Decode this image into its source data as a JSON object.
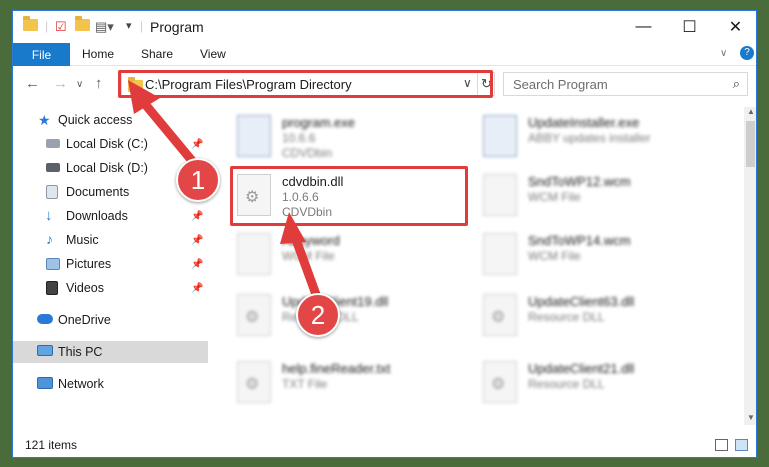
{
  "window": {
    "title": "Program",
    "minimize": "—",
    "maximize": "☐",
    "close": "✕"
  },
  "ribbon": {
    "file": "File",
    "tabs": [
      "Home",
      "Share",
      "View"
    ]
  },
  "address": {
    "path": "C:\\Program Files\\Program Directory",
    "search_placeholder": "Search Program"
  },
  "sidebar": [
    {
      "label": "Quick access",
      "icon": "star-icon",
      "pinned": false
    },
    {
      "label": "Local Disk (C:)",
      "icon": "drive-icon",
      "pinned": true
    },
    {
      "label": "Local Disk (D:)",
      "icon": "drive-icon",
      "pinned": false
    },
    {
      "label": "Documents",
      "icon": "documents-icon",
      "pinned": true
    },
    {
      "label": "Downloads",
      "icon": "download-icon",
      "pinned": true
    },
    {
      "label": "Music",
      "icon": "music-icon",
      "pinned": true
    },
    {
      "label": "Pictures",
      "icon": "pictures-icon",
      "pinned": true
    },
    {
      "label": "Videos",
      "icon": "videos-icon",
      "pinned": true
    },
    {
      "label": "OneDrive",
      "icon": "cloud-icon",
      "pinned": false
    },
    {
      "label": "This PC",
      "icon": "monitor-icon",
      "pinned": false,
      "selected": true
    },
    {
      "label": "Network",
      "icon": "network-icon",
      "pinned": false
    }
  ],
  "files": [
    {
      "name": "program.exe",
      "line2": "10.6.6",
      "line3": "CDVDbin",
      "blurred": true
    },
    {
      "name": "UpdateInstaller.exe",
      "line2": "ABBY updates installer",
      "line3": "",
      "blurred": true
    },
    {
      "name": "cdvdbin.dll",
      "line2": "1.0.6.6",
      "line3": "CDVDbin",
      "blurred": false
    },
    {
      "name": "SndToWP12.wcm",
      "line2": "WCM File",
      "line3": "",
      "blurred": true
    },
    {
      "name": "Abbyword",
      "line2": "WCM File",
      "line3": "",
      "blurred": true
    },
    {
      "name": "SndToWP14.wcm",
      "line2": "WCM File",
      "line3": "",
      "blurred": true
    },
    {
      "name": "UpdateClient19.dll",
      "line2": "Resource DLL",
      "line3": "",
      "blurred": true
    },
    {
      "name": "UpdateClient63.dll",
      "line2": "Resource DLL",
      "line3": "",
      "blurred": true
    },
    {
      "name": "help.fineReader.txt",
      "line2": "TXT File",
      "line3": "",
      "blurred": true
    },
    {
      "name": "UpdateClient21.dll",
      "line2": "Resource DLL",
      "line3": "",
      "blurred": true
    }
  ],
  "status": {
    "items": "121 items"
  },
  "annotations": {
    "step1": "1",
    "step2": "2",
    "color": "#e03c3c"
  }
}
